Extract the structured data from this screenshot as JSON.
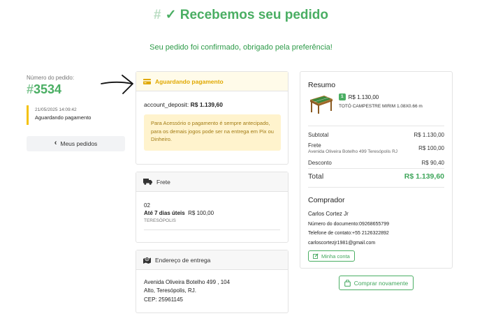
{
  "header": {
    "title_hash": "#",
    "title": "✓ Recebemos seu pedido",
    "subtitle": "Seu pedido foi confirmado, obrigado pela preferência!"
  },
  "order": {
    "label": "Número do pedido:",
    "hash": "#",
    "number": "3534",
    "timeline_date": "21/05/2025 14:09:42",
    "timeline_status": "Aguardando pagamento",
    "back_button": "Meus pedidos"
  },
  "payment": {
    "title": "Aguardando pagamento",
    "account_label": "account_deposit:",
    "account_value": "R$ 1.139,60",
    "notice": "Para Acessório o pagamento é sempre antecipado, para os demais jogos pode ser na entrega em Pix ou Dinheiro."
  },
  "shipping": {
    "title": "Frete",
    "qty": "02",
    "eta": "Até 7 dias úteis",
    "price": "R$ 100,00",
    "city": "TERESÓPOLIS"
  },
  "address": {
    "title": "Endereço de entrega",
    "line1": "Avenida Oliveira Botelho 499 , 104",
    "line2": "Alto, Teresópolis, RJ.",
    "cep": "CEP: 25961145"
  },
  "summary": {
    "title": "Resumo",
    "item_qty": "1",
    "item_price": "R$ 1.130,00",
    "item_name": "TOTÓ CAMPESTRE MIRIM 1.08X0.66 m",
    "subtotal_label": "Subtotal",
    "subtotal_value": "R$ 1.130,00",
    "frete_label": "Frete",
    "frete_address": "Avenida Oliveira Botelho 499 Teresópolis RJ",
    "frete_value": "R$ 100,00",
    "desconto_label": "Desconto",
    "desconto_value": "R$ 90,40",
    "total_label": "Total",
    "total_value": "R$ 1.139,60"
  },
  "buyer": {
    "title": "Comprador",
    "name": "Carlos Cortez Jr",
    "document": "Número do documento:09268655799",
    "phone": "Telefone de contato:+55 2126322892",
    "email": "carloscortezjr1981@gmail.com",
    "account_button": "Minha conta"
  },
  "actions": {
    "buy_again": "Comprar novamente"
  },
  "colors": {
    "accent": "#4aae63",
    "warning": "#e0a800",
    "notice_bg": "#fff3cd"
  }
}
